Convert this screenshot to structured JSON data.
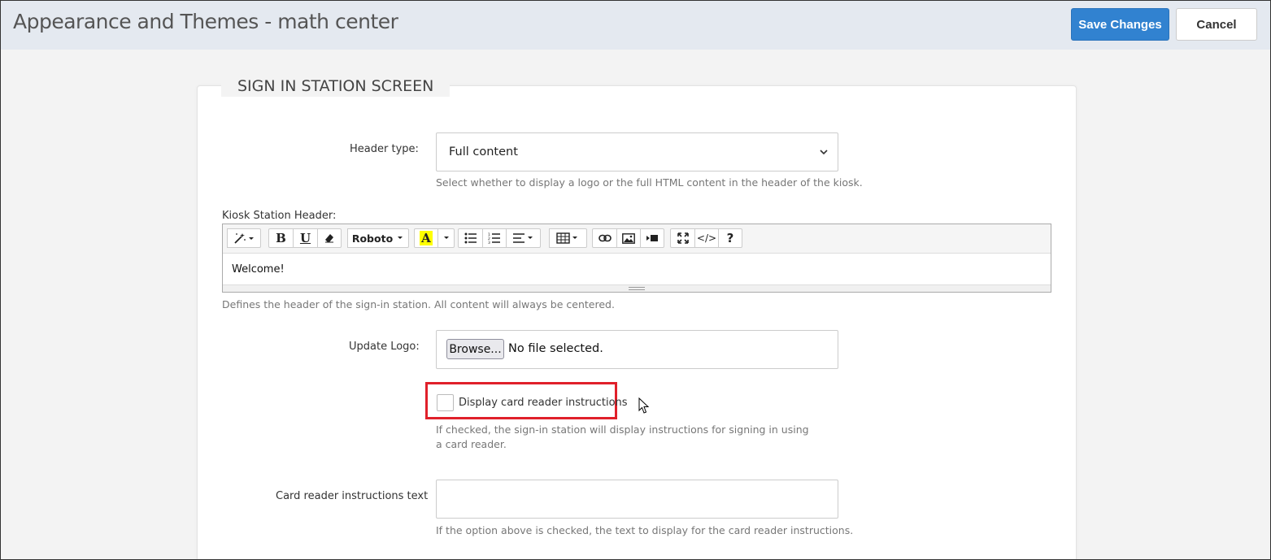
{
  "header": {
    "title": "Appearance and Themes - math center",
    "save_label": "Save Changes",
    "cancel_label": "Cancel"
  },
  "colors": {
    "accent": "#3182d0",
    "highlight": "#e0202a",
    "topbar_bg": "#e4e9f0"
  },
  "section": {
    "title": "SIGN IN STATION SCREEN"
  },
  "header_type": {
    "label": "Header type:",
    "value": "Full content",
    "help": "Select whether to display a logo or the full HTML content in the header of the kiosk."
  },
  "kiosk_header": {
    "label": "Kiosk Station Header:",
    "content": "Welcome!",
    "help": "Defines the header of the sign-in station. All content will always be centered.",
    "toolbar": {
      "font_name": "Roboto",
      "icons": [
        "magic-icon",
        "bold-icon",
        "underline-icon",
        "eraser-icon",
        "font-family-dropdown",
        "text-color-icon",
        "color-dropdown-icon",
        "unordered-list-icon",
        "ordered-list-icon",
        "align-icon",
        "table-icon",
        "link-icon",
        "picture-icon",
        "video-icon",
        "fullscreen-icon",
        "code-view-icon",
        "help-icon"
      ],
      "bold_glyph": "B",
      "underline_glyph": "U",
      "color_glyph": "A",
      "code_glyph": "</>",
      "help_glyph": "?"
    }
  },
  "logo": {
    "label": "Update Logo:",
    "browse_label": "Browse...",
    "file_status": "No file selected."
  },
  "card_reader": {
    "checkbox_label": "Display card reader instructions",
    "checked": false,
    "help": "If checked, the sign-in station will display instructions for signing in using a card reader."
  },
  "card_reader_text": {
    "label": "Card reader instructions text",
    "value": "",
    "help": "If the option above is checked, the text to display for the card reader instructions."
  }
}
